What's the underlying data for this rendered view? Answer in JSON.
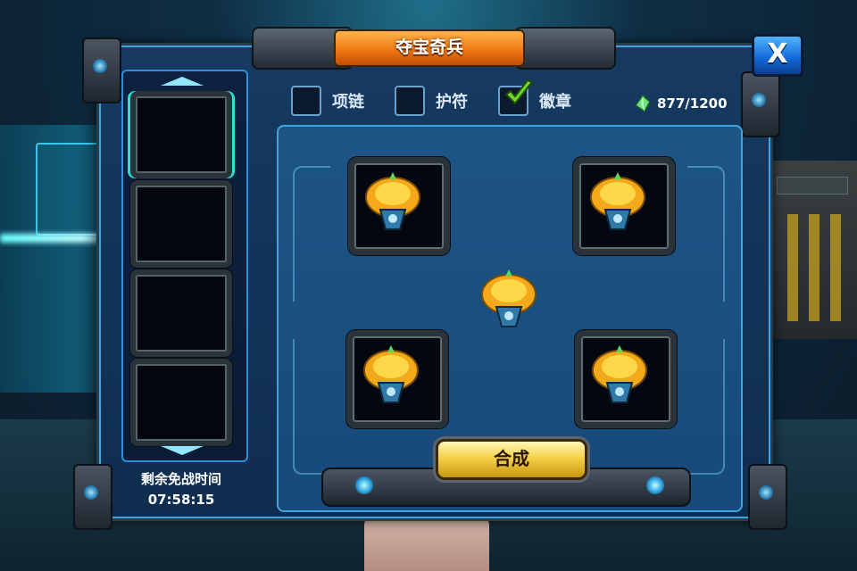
{
  "dialog": {
    "title": "夺宝奇兵",
    "close_label": "X"
  },
  "tabs": [
    {
      "label": "项链",
      "checked": false
    },
    {
      "label": "护符",
      "checked": false
    },
    {
      "label": "徽章",
      "checked": true
    }
  ],
  "currency": {
    "icon": "green-crystal-icon",
    "value": "877/1200"
  },
  "sidebar": {
    "slots": [
      "empty",
      "empty",
      "empty",
      "empty"
    ]
  },
  "timer": {
    "label": "剩余免战时间",
    "value": "07:58:15"
  },
  "combine": {
    "label": "合成",
    "result_item": "gold-badge-icon",
    "materials": [
      "gold-badge-icon",
      "gold-badge-icon",
      "gold-badge-icon",
      "gold-badge-icon"
    ]
  },
  "colors": {
    "title_orange": "#f07a12",
    "panel_blue": "#17497a",
    "accent_cyan": "#3fa5e0",
    "button_gold": "#f5d24a"
  }
}
